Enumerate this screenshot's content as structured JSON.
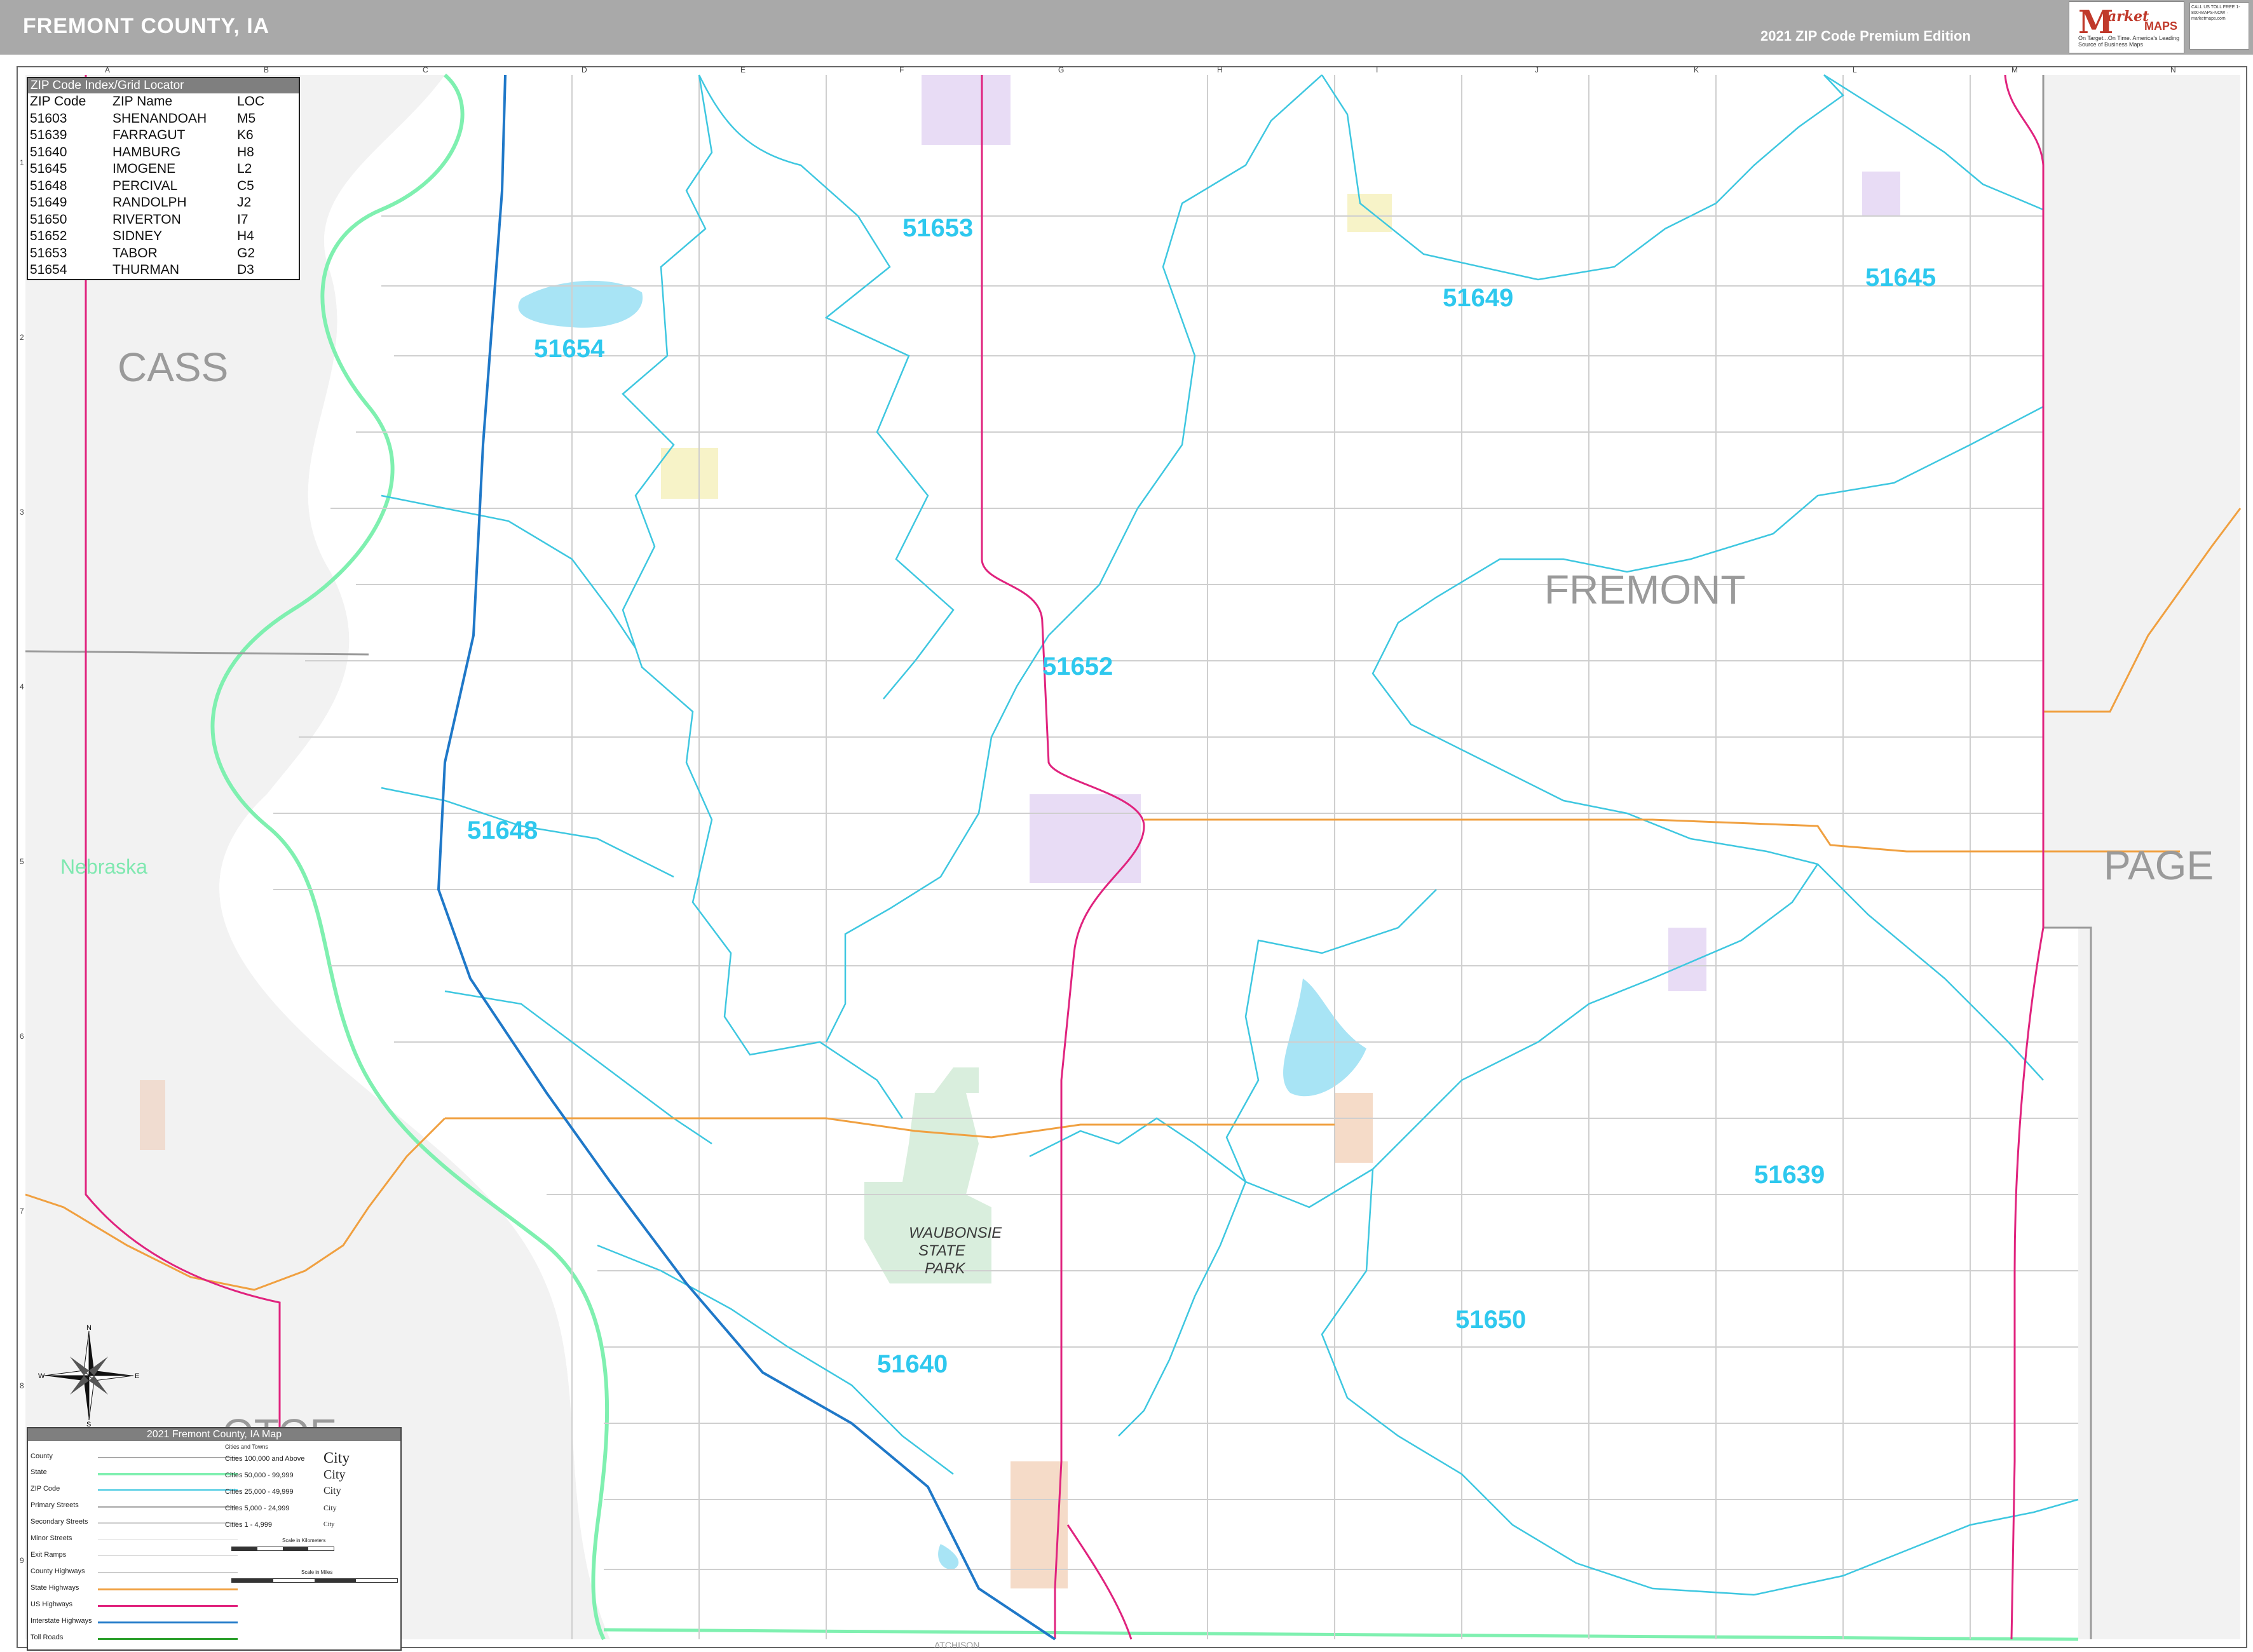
{
  "header": {
    "title": "FREMONT COUNTY, IA",
    "edition": "2021 ZIP Code Premium Edition"
  },
  "logo": {
    "brand_m": "M",
    "brand_arket": "arket",
    "brand_maps": "MAPS",
    "tagline": "On Target...On Time. America's Leading Source of Business Maps",
    "contact": "CALL US TOLL FREE 1-800-MAPS-NOW · marketmaps.com"
  },
  "grid": {
    "columns": [
      "A",
      "B",
      "C",
      "D",
      "E",
      "F",
      "G",
      "H",
      "I",
      "J",
      "K",
      "L",
      "M",
      "N"
    ],
    "rows": [
      "1",
      "2",
      "3",
      "4",
      "5",
      "6",
      "7",
      "8",
      "9"
    ]
  },
  "zip_index": {
    "title": "ZIP Code Index/Grid Locator",
    "columns": [
      "ZIP Code",
      "ZIP Name",
      "LOC"
    ],
    "rows": [
      [
        "51603",
        "SHENANDOAH",
        "M5"
      ],
      [
        "51639",
        "FARRAGUT",
        "K6"
      ],
      [
        "51640",
        "HAMBURG",
        "H8"
      ],
      [
        "51645",
        "IMOGENE",
        "L2"
      ],
      [
        "51648",
        "PERCIVAL",
        "C5"
      ],
      [
        "51649",
        "RANDOLPH",
        "J2"
      ],
      [
        "51650",
        "RIVERTON",
        "I7"
      ],
      [
        "51652",
        "SIDNEY",
        "H4"
      ],
      [
        "51653",
        "TABOR",
        "G2"
      ],
      [
        "51654",
        "THURMAN",
        "D3"
      ]
    ]
  },
  "zip_labels": [
    {
      "code": "51653"
    },
    {
      "code": "51649"
    },
    {
      "code": "51645"
    },
    {
      "code": "51654"
    },
    {
      "code": "51652"
    },
    {
      "code": "51648"
    },
    {
      "code": "51639"
    },
    {
      "code": "51650"
    },
    {
      "code": "51640"
    }
  ],
  "region_labels": {
    "cass": "CASS",
    "fremont": "FREMONT",
    "page": "PAGE",
    "otoe": "OTOE",
    "nebraska": "Nebraska",
    "park": [
      "WAUBONSIE",
      "STATE",
      "PARK"
    ],
    "atchison": "ATCHISON"
  },
  "legend": {
    "title": "2021 Fremont County, IA Map",
    "items": [
      "County",
      "State",
      "ZIP Code",
      "Primary Streets",
      "Secondary Streets",
      "Minor Streets",
      "Exit Ramps",
      "County Highways",
      "State Highways",
      "US Highways",
      "Interstate Highways",
      "Toll Roads"
    ],
    "cities_title": "Cities and Towns",
    "cities": [
      "Cities 100,000 and Above",
      "Cities 50,000 - 99,999",
      "Cities 25,000 - 49,999",
      "Cities 5,000 - 24,999",
      "Cities 1 - 4,999"
    ],
    "city_samples": [
      "City",
      "City",
      "City",
      "City",
      "City"
    ],
    "scale_km": "Scale in Kilometers",
    "scale_mi": "Scale in Miles"
  },
  "compass": {
    "n": "N",
    "s": "S",
    "e": "E",
    "w": "W"
  },
  "colors": {
    "zip_boundary": "#3ec7e0",
    "zip_label": "#2ec8ee",
    "us_highway": "#e0237e",
    "interstate": "#1f78c8",
    "state_highway": "#f0a040",
    "state_line": "#7ff0b0",
    "county_label": "#9a9a9a",
    "water": "#a8e4f5",
    "outside": "#f2f2f2"
  }
}
